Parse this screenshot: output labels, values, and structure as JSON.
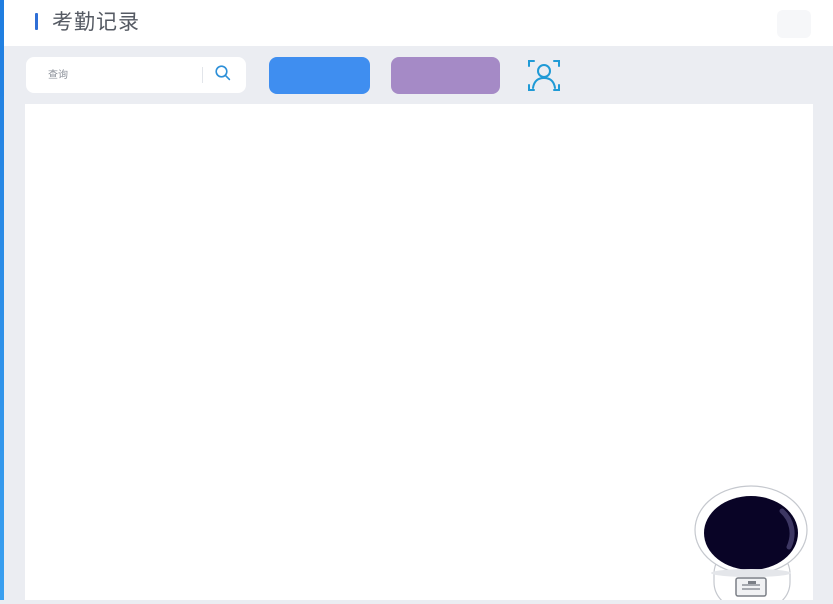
{
  "page": {
    "title": "考勤记录"
  },
  "search": {
    "placeholder": "查询",
    "icon": "search-icon"
  },
  "toolbar": {
    "primary_button_label": "",
    "secondary_button_label": "",
    "face_button_icon": "face-scan-icon"
  },
  "colors": {
    "accent": "#2f6fd6",
    "primary_button": "#3f8ef0",
    "secondary_button": "#a58ac6",
    "background": "#ebedf2"
  }
}
